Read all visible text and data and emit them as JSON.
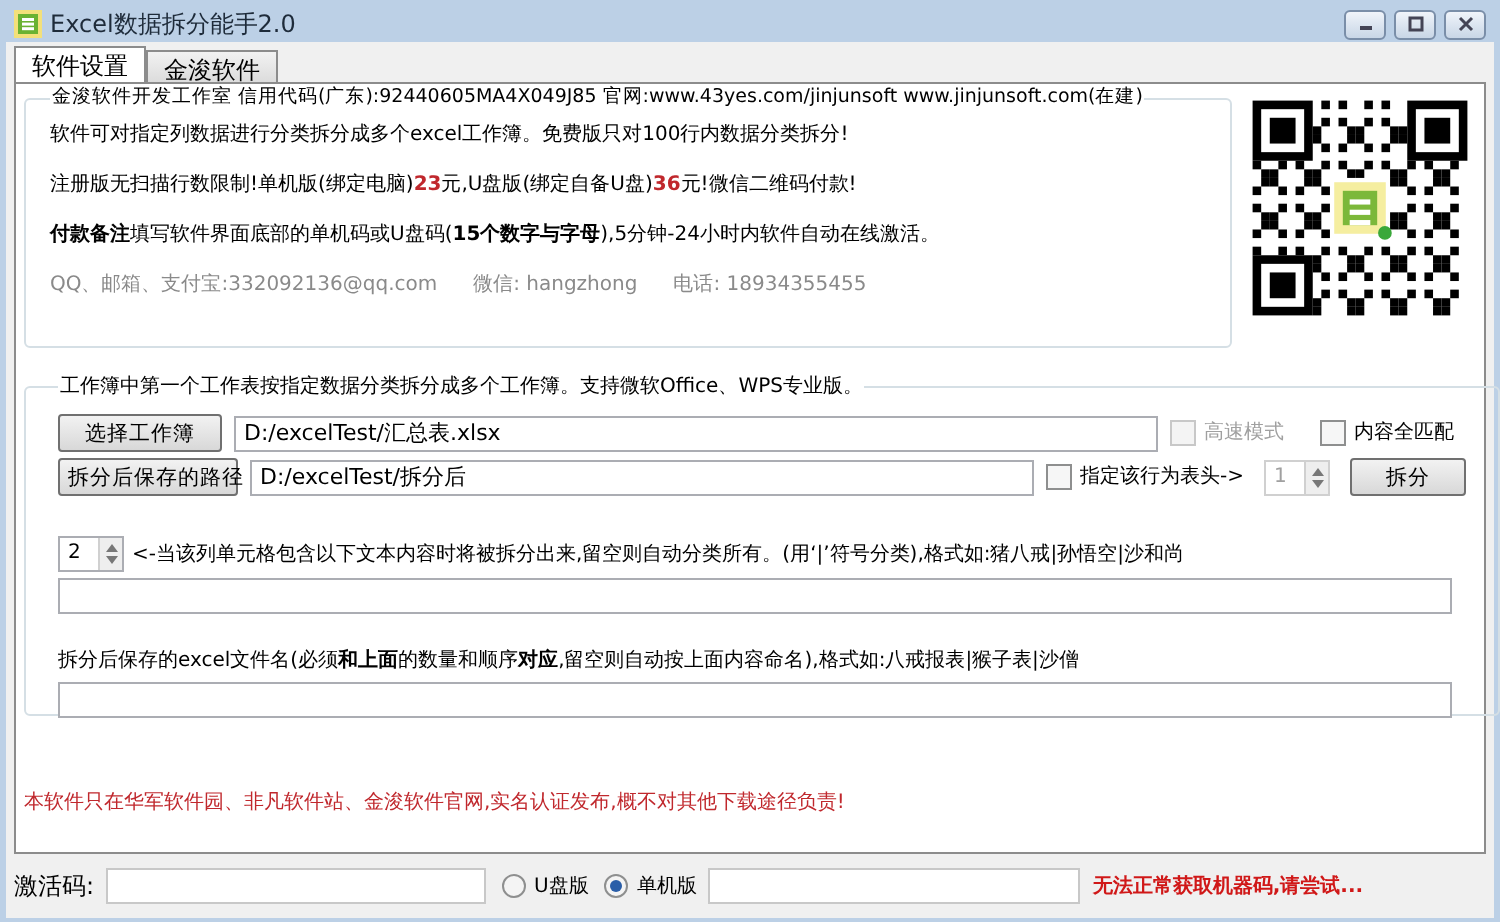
{
  "window": {
    "title": "Excel数据拆分能手2.0"
  },
  "tabs": [
    {
      "label": "软件设置",
      "selected": true
    },
    {
      "label": "金浚软件",
      "selected": false
    }
  ],
  "info_group": {
    "title": "金浚软件开发工作室 信用代码(广东):92440605MA4X049J85 官网:www.43yes.com/jinjunsoft  www.jinjunsoft.com(在建)",
    "lines": [
      [
        {
          "kind": "plain",
          "text": "软件可对指定列数据进行分类拆分成多个excel工作簿。免费版只对100行内数据分类拆分!"
        }
      ],
      [
        {
          "kind": "plain",
          "text": "注册版无扫描行数限制!单机版(绑定电脑)"
        },
        {
          "kind": "price",
          "text": "23"
        },
        {
          "kind": "plain",
          "text": "元,U盘版(绑定自备U盘)"
        },
        {
          "kind": "price",
          "text": "36"
        },
        {
          "kind": "plain",
          "text": "元!微信二维码付款!"
        }
      ],
      [
        {
          "kind": "plain",
          "text": "**付款备注**填写软件界面底部的单机码或U盘码(**15个数字与字母**),5分钟-24小时内软件自动在线激活。"
        }
      ]
    ],
    "contacts": [
      "QQ、邮箱、支付宝:332092136@qq.com",
      "微信: hangzhong",
      "电话: 18934355455"
    ]
  },
  "split_group": {
    "title": "工作簿中第一个工作表按指定数据分类拆分成多个工作簿。支持微软Office、WPS专业版。",
    "select_button": "选择工作簿",
    "source_path": "D:/excelTest/汇总表.xlsx",
    "fast_mode": {
      "label": "高速模式",
      "checked": false,
      "disabled": true
    },
    "full_match": {
      "label": "内容全匹配",
      "checked": false,
      "disabled": false
    },
    "save_button": "拆分后保存的路径",
    "save_path": "D:/excelTest/拆分后",
    "header_row": {
      "label": "指定该行为表头->",
      "checked": false,
      "disabled": false
    },
    "header_row_number": {
      "value": "1",
      "disabled": true
    },
    "split_button": "拆分",
    "column_number": {
      "value": "2",
      "disabled": false
    },
    "filter_hint": "<-当该列单元格包含以下文本内容时将被拆分出来,留空则自动分类所有。(用‘|’符号分类),格式如:猪八戒|孙悟空|沙和尚",
    "names_hint": "拆分后保存的excel文件名(必须**和上面**的数量和顺序**对应**,留空则自动按上面内容命名),格式如:八戒报表|猴子表|沙僧"
  },
  "notice": "本软件只在华军软件园、非凡软件站、金浚软件官网,实名认证发布,概不对其他下载途径负责!",
  "status_bar": {
    "activation_label": "激活码:",
    "editions": [
      {
        "label": "U盘版",
        "selected": false
      },
      {
        "label": "单机版",
        "selected": true
      }
    ],
    "message": "无法正常获取机器码,请尝试..."
  }
}
